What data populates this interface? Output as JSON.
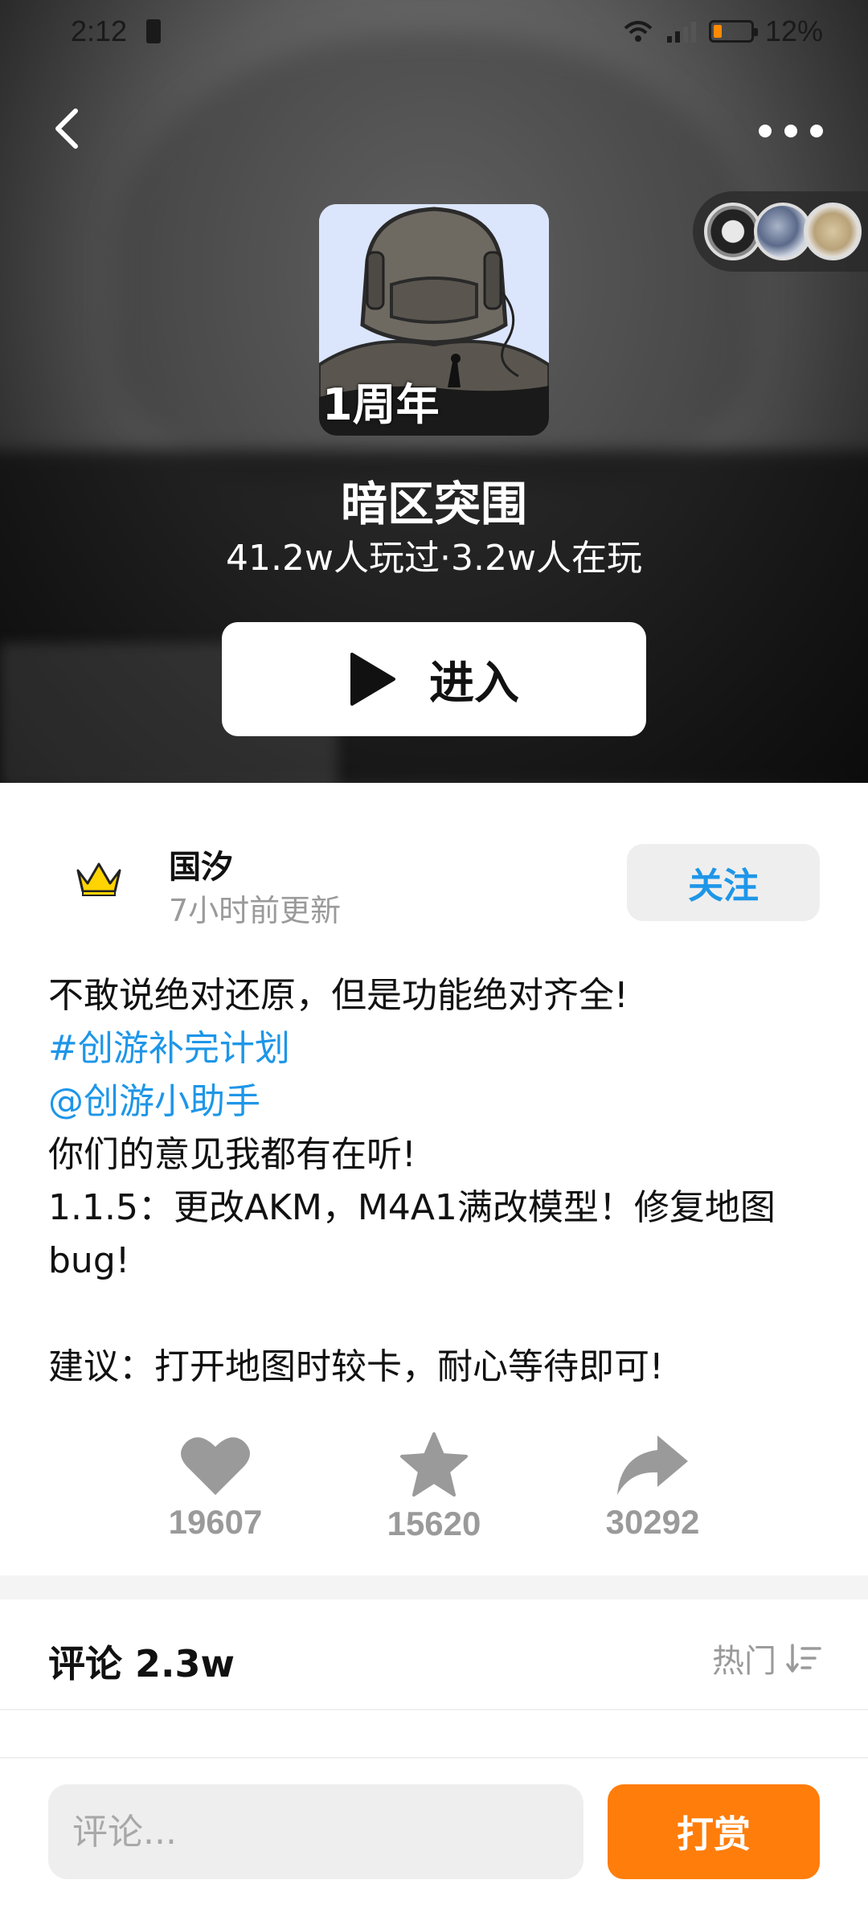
{
  "status_bar": {
    "time": "2:12",
    "battery_percent": "12%",
    "network": "4G"
  },
  "game": {
    "icon_badge": "1周年",
    "title": "暗区突围",
    "stats": "41.2w人玩过·3.2w人在玩",
    "enter_label": "进入"
  },
  "author": {
    "name": "国汐",
    "updated": "7小时前更新",
    "follow_label": "关注"
  },
  "post": {
    "line1": "不敢说绝对还原，但是功能绝对齐全!",
    "hashtag": "#创游补完计划",
    "mention": " @创游小助手",
    "line4": "你们的意见我都有在听!",
    "line5": "1.1.5：更改AKM，M4A1满改模型！修复地图bug!",
    "line6": "",
    "line7": "建议：打开地图时较卡，耐心等待即可!"
  },
  "actions": {
    "likes": "19607",
    "favorites": "15620",
    "shares": "30292"
  },
  "comments": {
    "header": "评论 2.3w",
    "sort_label": "热门"
  },
  "bottom_bar": {
    "comment_placeholder": "评论...",
    "reward_label": "打赏"
  },
  "colors": {
    "accent_blue": "#1e96e8",
    "reward_orange": "#ff7d0a",
    "muted_gray": "#9a9a9a"
  }
}
